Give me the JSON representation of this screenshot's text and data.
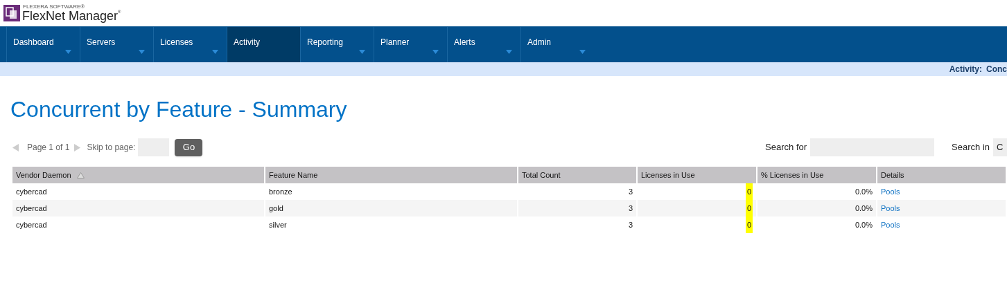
{
  "logo": {
    "company": "FLEXERA SOFTWARE®",
    "product": "FlexNet Manager",
    "mark": "®"
  },
  "nav": [
    {
      "label": "Dashboard",
      "selected": false,
      "has_menu": true
    },
    {
      "label": "Servers",
      "selected": false,
      "has_menu": true
    },
    {
      "label": "Licenses",
      "selected": false,
      "has_menu": true
    },
    {
      "label": "Activity",
      "selected": true,
      "has_menu": false
    },
    {
      "label": "Reporting",
      "selected": false,
      "has_menu": true
    },
    {
      "label": "Planner",
      "selected": false,
      "has_menu": true
    },
    {
      "label": "Alerts",
      "selected": false,
      "has_menu": true
    },
    {
      "label": "Admin",
      "selected": false,
      "has_menu": true
    }
  ],
  "breadcrumb": {
    "section": "Activity:",
    "page": "Conc"
  },
  "title": "Concurrent by Feature - Summary",
  "pager": {
    "page_text": "Page 1 of 1",
    "skip_label": "Skip to page:",
    "go": "Go"
  },
  "search": {
    "for_label": "Search for",
    "in_label": "Search in",
    "in_value": "C"
  },
  "table": {
    "columns": [
      {
        "label": "Vendor Daemon",
        "sorted": true
      },
      {
        "label": "Feature Name",
        "sorted": false
      },
      {
        "label": "Total Count",
        "sorted": false
      },
      {
        "label": "Licenses in Use",
        "sorted": false
      },
      {
        "label": "% Licenses in Use",
        "sorted": false
      },
      {
        "label": "Details",
        "sorted": false
      }
    ],
    "rows": [
      {
        "cells": [
          "cybercad",
          "bronze",
          "3",
          "0",
          "0.0%",
          "Pools"
        ],
        "in_use_highlighted": true
      },
      {
        "cells": [
          "cybercad",
          "gold",
          "3",
          "0",
          "0.0%",
          "Pools"
        ],
        "in_use_highlighted": true
      },
      {
        "cells": [
          "cybercad",
          "silver",
          "3",
          "0",
          "0.0%",
          "Pools"
        ],
        "in_use_highlighted": true
      }
    ]
  }
}
